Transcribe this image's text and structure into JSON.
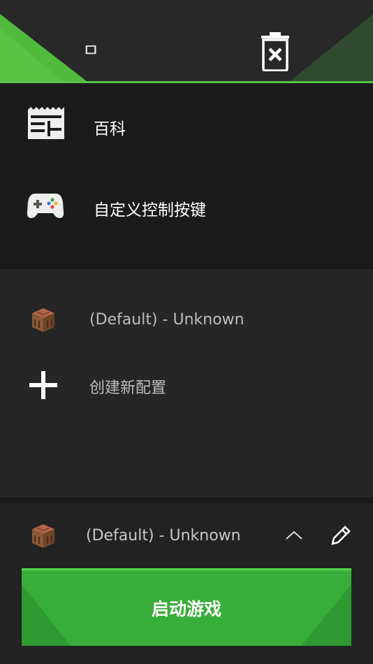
{
  "header": {
    "title": "ㅁ"
  },
  "menu": {
    "items": [
      {
        "label": "百科",
        "icon": "wiki-news-icon"
      },
      {
        "label": "自定义控制按键",
        "icon": "gamepad-icon"
      }
    ]
  },
  "profiles": {
    "items": [
      {
        "label": "(Default) - Unknown",
        "icon": "crafting-table-icon"
      },
      {
        "label": "创建新配置",
        "icon": "plus-icon"
      }
    ]
  },
  "selected_profile": {
    "label": "(Default) - Unknown",
    "icon": "crafting-table-icon"
  },
  "play_button": {
    "label": "启动游戏"
  },
  "colors": {
    "accent": "#5ac14a",
    "play": "#39ad3a",
    "menu_bg": "#1b1b1b",
    "list_bg": "#262626"
  }
}
